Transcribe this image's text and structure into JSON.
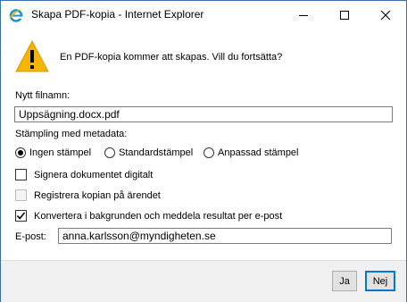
{
  "window": {
    "title": "Skapa PDF-kopia - Internet Explorer",
    "app_icon": "internet-explorer-icon",
    "controls": [
      "minimize",
      "maximize",
      "close"
    ]
  },
  "dialog": {
    "icon": "warning-icon",
    "prompt": "En PDF-kopia kommer att skapas. Vill du fortsätta?",
    "filename_label": "Nytt filnamn:",
    "filename_value": "Uppsägning.docx.pdf",
    "stamping_label": "Stämpling med metadata:",
    "stamping_options": [
      {
        "label": "Ingen stämpel",
        "selected": true
      },
      {
        "label": "Standardstämpel",
        "selected": false
      },
      {
        "label": "Anpassad stämpel",
        "selected": false
      }
    ],
    "checkboxes": [
      {
        "label": "Signera dokumentet digitalt",
        "checked": false,
        "enabled": true
      },
      {
        "label": "Registrera kopian på ärendet",
        "checked": false,
        "enabled": false
      },
      {
        "label": "Konvertera i bakgrunden och meddela resultat per e-post",
        "checked": true,
        "enabled": true
      }
    ],
    "email_label": "E-post:",
    "email_value": "anna.karlsson@myndigheten.se"
  },
  "buttons": {
    "yes": "Ja",
    "no": "Nej"
  },
  "colors": {
    "title_border": "#3c6fae",
    "warning_fill": "#f5b400",
    "ie_blue": "#1e8fd6",
    "default_button_border": "#0078d7"
  }
}
